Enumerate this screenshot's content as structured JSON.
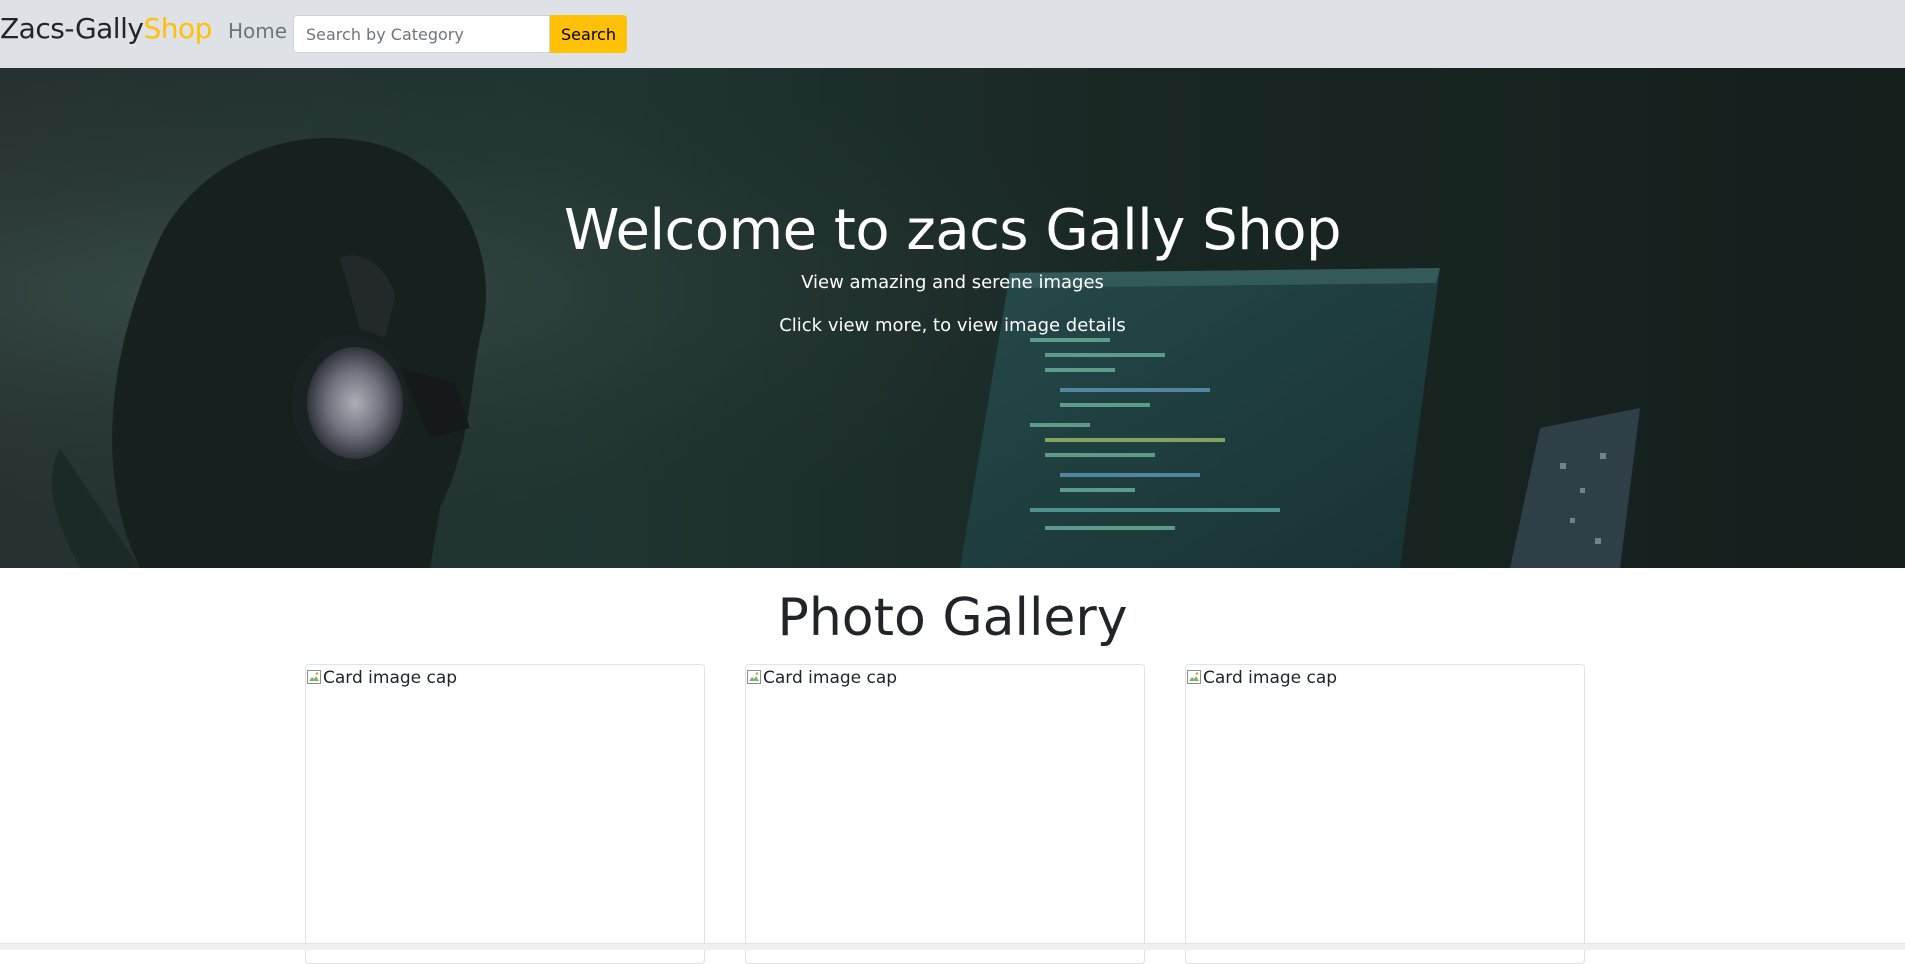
{
  "navbar": {
    "brand_main": "Zacs-Gally",
    "brand_accent": "Shop",
    "home_label": "Home",
    "search_placeholder": "Search by Category",
    "search_value": "",
    "search_button_label": "Search",
    "background_color": "#dee2e6",
    "accent_color": "#ffc107"
  },
  "hero": {
    "title": "Welcome to zacs Gally Shop",
    "subtitle": "View amazing and serene images",
    "hint": "Click view more, to view image details",
    "background_image_description": "person-with-headphones-coding-icon"
  },
  "gallery": {
    "title": "Photo Gallery",
    "cards": [
      {
        "image_alt": "Card image cap",
        "icon": "broken-image-icon"
      },
      {
        "image_alt": "Card image cap",
        "icon": "broken-image-icon"
      },
      {
        "image_alt": "Card image cap",
        "icon": "broken-image-icon"
      }
    ]
  }
}
